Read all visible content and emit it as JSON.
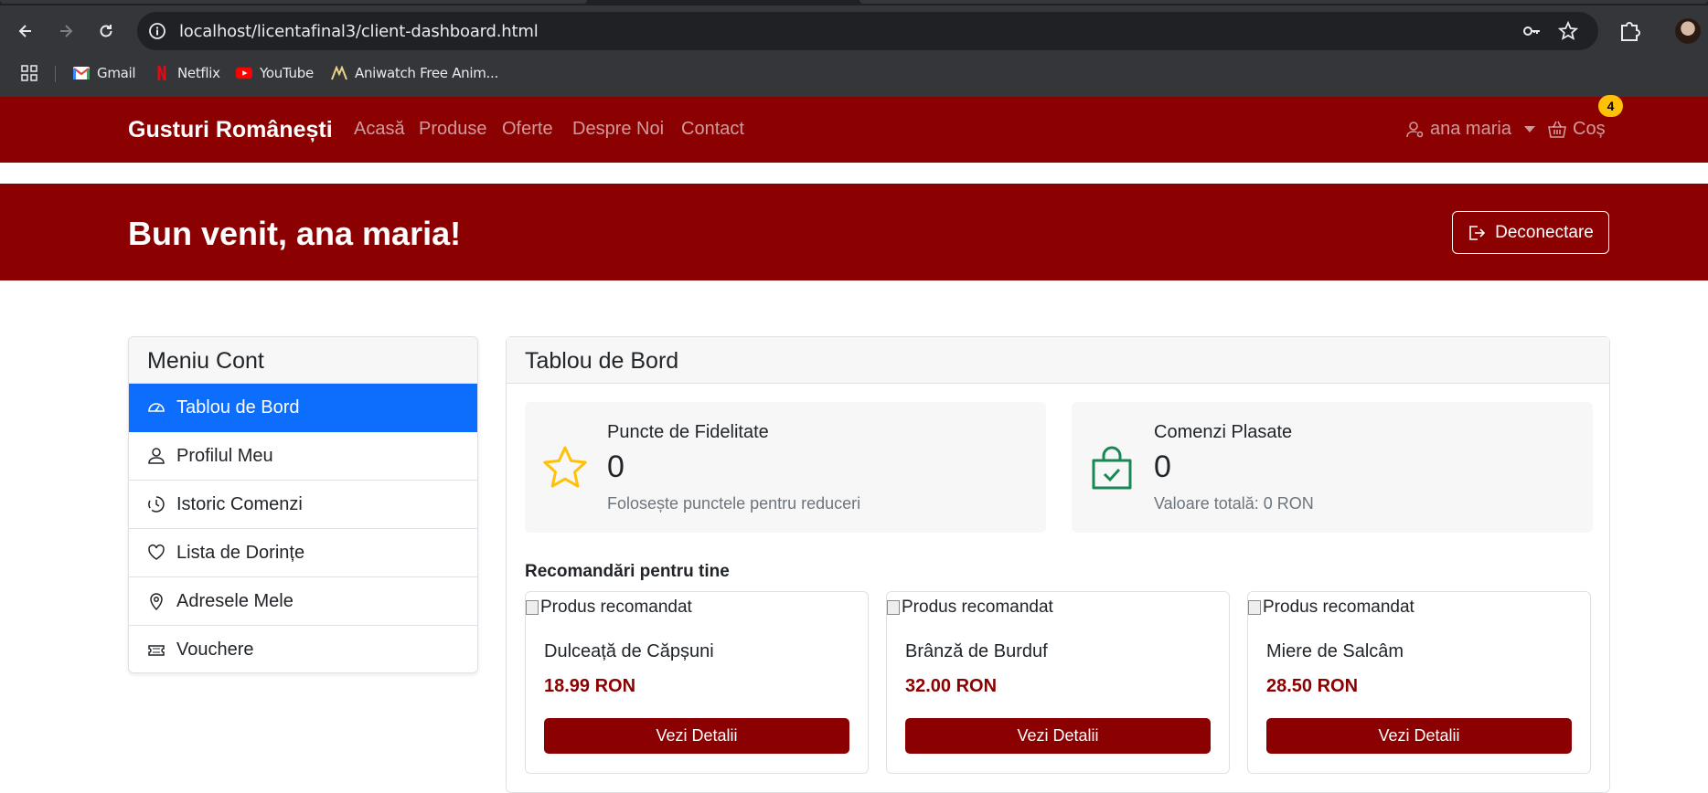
{
  "browser": {
    "url": "localhost/licentafinal3/client-dashboard.html",
    "bookmarks": [
      {
        "label": "Gmail",
        "icon": "gmail-icon"
      },
      {
        "label": "Netflix",
        "icon": "netflix-icon"
      },
      {
        "label": "YouTube",
        "icon": "youtube-icon"
      },
      {
        "label": "Aniwatch Free Anim...",
        "icon": "aniwatch-icon"
      }
    ]
  },
  "navbar": {
    "brand": "Gusturi Românești",
    "links": [
      "Acasă",
      "Produse",
      "Oferte",
      "Despre Noi",
      "Contact"
    ],
    "user": "ana maria",
    "cart_label": "Coș",
    "cart_count": "4",
    "color": "#8b0000"
  },
  "hero": {
    "title": "Bun venit, ana maria!",
    "logout_label": "Deconectare"
  },
  "sidebar": {
    "title": "Meniu Cont",
    "items": [
      {
        "label": "Tablou de Bord",
        "icon": "dashboard-gauge-icon",
        "active": true
      },
      {
        "label": "Profilul Meu",
        "icon": "person-icon",
        "active": false
      },
      {
        "label": "Istoric Comenzi",
        "icon": "clock-history-icon",
        "active": false
      },
      {
        "label": "Lista de Dorințe",
        "icon": "heart-icon",
        "active": false
      },
      {
        "label": "Adresele Mele",
        "icon": "location-pin-icon",
        "active": false
      },
      {
        "label": "Vouchere",
        "icon": "ticket-icon",
        "active": false
      }
    ],
    "active_color": "#0d6efd"
  },
  "dashboard": {
    "title": "Tablou de Bord",
    "stats": [
      {
        "label": "Puncte de Fidelitate",
        "value": "0",
        "sub": "Folosește punctele pentru reduceri",
        "icon": "star-icon",
        "color": "#ffc107"
      },
      {
        "label": "Comenzi Plasate",
        "value": "0",
        "sub": "Valoare totală: 0 RON",
        "icon": "bag-check-icon",
        "color": "#198754"
      }
    ],
    "recommendations_title": "Recomandări pentru tine",
    "products": [
      {
        "img_alt": "Produs recomandat",
        "name": "Dulceață de Căpșuni",
        "price": "18.99 RON",
        "button": "Vezi Detalii"
      },
      {
        "img_alt": "Produs recomandat",
        "name": "Brânză de Burduf",
        "price": "32.00 RON",
        "button": "Vezi Detalii"
      },
      {
        "img_alt": "Produs recomandat",
        "name": "Miere de Salcâm",
        "price": "28.50 RON",
        "button": "Vezi Detalii"
      }
    ]
  }
}
